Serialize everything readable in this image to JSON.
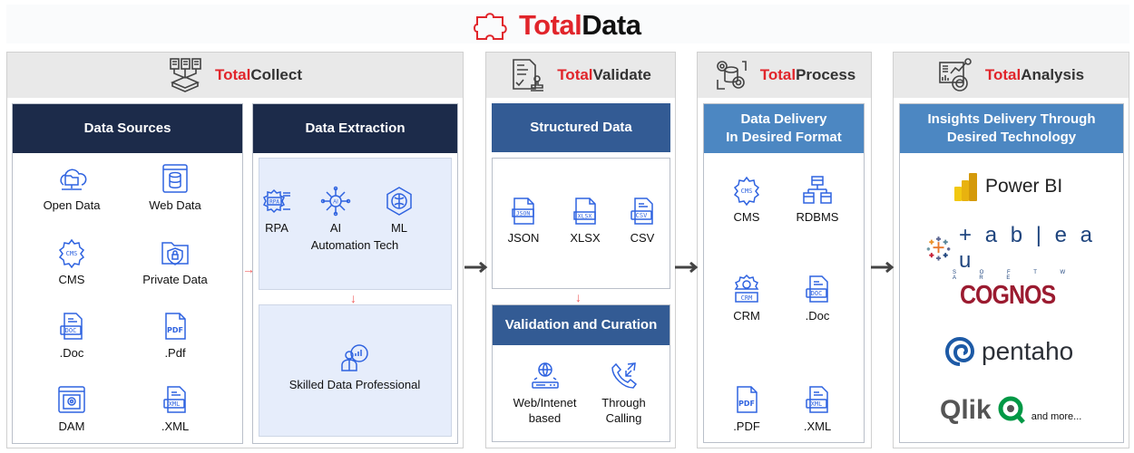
{
  "brand": {
    "part1": "Total",
    "part2": "Data",
    "icon": "puzzle-piece-icon"
  },
  "sections": {
    "collect": {
      "title_red": "Total",
      "title_rest": "Collect",
      "icon": "data-collect-icon"
    },
    "validate": {
      "title_red": "Total",
      "title_rest": "Validate",
      "icon": "document-stamp-icon"
    },
    "process": {
      "title_red": "Total",
      "title_rest": "Process",
      "icon": "gears-database-icon"
    },
    "analysis": {
      "title_red": "Total",
      "title_rest": "Analysis",
      "icon": "analytics-dashboard-icon"
    }
  },
  "data_sources": {
    "heading": "Data Sources",
    "items": [
      {
        "label": "Open Data",
        "icon": "cloud-folder-icon"
      },
      {
        "label": "Web Data",
        "icon": "web-database-icon"
      },
      {
        "label": "CMS",
        "icon": "cms-gear-icon"
      },
      {
        "label": "Private Data",
        "icon": "secure-folder-icon"
      },
      {
        "label": ".Doc",
        "icon": "doc-file-icon"
      },
      {
        "label": ".Pdf",
        "icon": "pdf-file-icon"
      },
      {
        "label": "DAM",
        "icon": "dam-window-icon"
      },
      {
        "label": ".XML",
        "icon": "xml-file-icon"
      }
    ]
  },
  "data_extraction": {
    "heading": "Data Extraction",
    "automation": {
      "caption": "Automation Tech",
      "items": [
        {
          "label": "RPA",
          "icon": "rpa-gear-icon"
        },
        {
          "label": "AI",
          "icon": "ai-chip-icon"
        },
        {
          "label": "ML",
          "icon": "ml-brain-icon"
        }
      ]
    },
    "professional": {
      "caption": "Skilled Data Professional",
      "icon": "data-professional-icon"
    }
  },
  "structured_data": {
    "heading": "Structured Data",
    "items": [
      {
        "label": "JSON",
        "icon": "json-file-icon"
      },
      {
        "label": "XLSX",
        "icon": "xlsx-file-icon"
      },
      {
        "label": "CSV",
        "icon": "csv-file-icon"
      }
    ]
  },
  "validation": {
    "heading": "Validation and Curation",
    "items": [
      {
        "label1": "Web/Intenet",
        "label2": "based",
        "icon": "globe-router-icon"
      },
      {
        "label1": "Through",
        "label2": "Calling",
        "icon": "phone-call-icon"
      }
    ]
  },
  "delivery": {
    "heading_line1": "Data Delivery",
    "heading_line2": "In Desired Format",
    "items": [
      {
        "label": "CMS",
        "icon": "cms-gear-icon"
      },
      {
        "label": "RDBMS",
        "icon": "rdbms-tree-icon"
      },
      {
        "label": "CRM",
        "icon": "crm-gear-icon"
      },
      {
        "label": ".Doc",
        "icon": "doc-file-icon"
      },
      {
        "label": ".PDF",
        "icon": "pdf-file-icon"
      },
      {
        "label": ".XML",
        "icon": "xml-file-icon"
      }
    ]
  },
  "insights": {
    "heading_line1": "Insights Delivery Through",
    "heading_line2": "Desired Technology",
    "logos": {
      "powerbi": "Power BI",
      "tableau": "+ a b | e a u",
      "tableau_sub": "S O F T W A R E",
      "cognos": "COGNOS",
      "pentaho": "pentaho",
      "qlik": "Qlik"
    },
    "and_more": "and more..."
  },
  "colors": {
    "brand_red": "#e1252b",
    "navy": "#1c2b4a",
    "mid_blue": "#335b94",
    "light_blue": "#4c87c2",
    "icon_blue": "#2f63e0"
  }
}
